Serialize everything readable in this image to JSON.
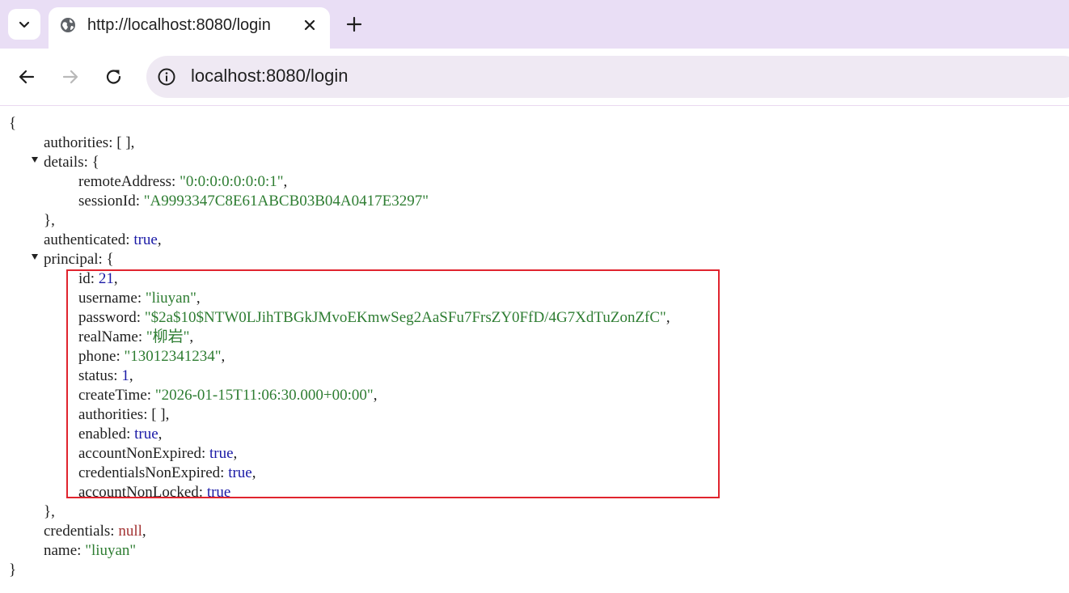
{
  "browser": {
    "tab": {
      "title": "http://localhost:8080/login"
    },
    "address_bar": {
      "url": "localhost:8080/login"
    }
  },
  "json_view": {
    "open_brace": "{",
    "close_brace": "}",
    "authorities": {
      "key": "authorities",
      "value": "[ ]"
    },
    "details": {
      "key": "details",
      "remoteAddress": {
        "key": "remoteAddress",
        "value": "\"0:0:0:0:0:0:0:1\""
      },
      "sessionId": {
        "key": "sessionId",
        "value": "\"A9993347C8E61ABCB03B04A0417E3297\""
      }
    },
    "authenticated": {
      "key": "authenticated",
      "value": "true"
    },
    "principal": {
      "key": "principal",
      "id": {
        "key": "id",
        "value": "21"
      },
      "username": {
        "key": "username",
        "value": "\"liuyan\""
      },
      "password": {
        "key": "password",
        "value": "\"$2a$10$NTW0LJihTBGkJMvoEKmwSeg2AaSFu7FrsZY0FfD/4G7XdTuZonZfC\""
      },
      "realName": {
        "key": "realName",
        "value": "\"柳岩\""
      },
      "phone": {
        "key": "phone",
        "value": "\"13012341234\""
      },
      "status": {
        "key": "status",
        "value": "1"
      },
      "createTime": {
        "key": "createTime",
        "value": "\"2026-01-15T11:06:30.000+00:00\""
      },
      "authorities": {
        "key": "authorities",
        "value": "[ ]"
      },
      "enabled": {
        "key": "enabled",
        "value": "true"
      },
      "accountNonExpired": {
        "key": "accountNonExpired",
        "value": "true"
      },
      "credentialsNonExpired": {
        "key": "credentialsNonExpired",
        "value": "true"
      },
      "accountNonLocked": {
        "key": "accountNonLocked",
        "value": "true"
      }
    },
    "credentials": {
      "key": "credentials",
      "value": "null"
    },
    "name": {
      "key": "name",
      "value": "\"liuyan\""
    }
  },
  "colors": {
    "tabstrip": "#e9def5",
    "omnibox": "#efe9f3",
    "string": "#2e7d32",
    "boolean": "#1a1aa6",
    "null": "#a33333",
    "highlight_border": "#e0242e"
  }
}
